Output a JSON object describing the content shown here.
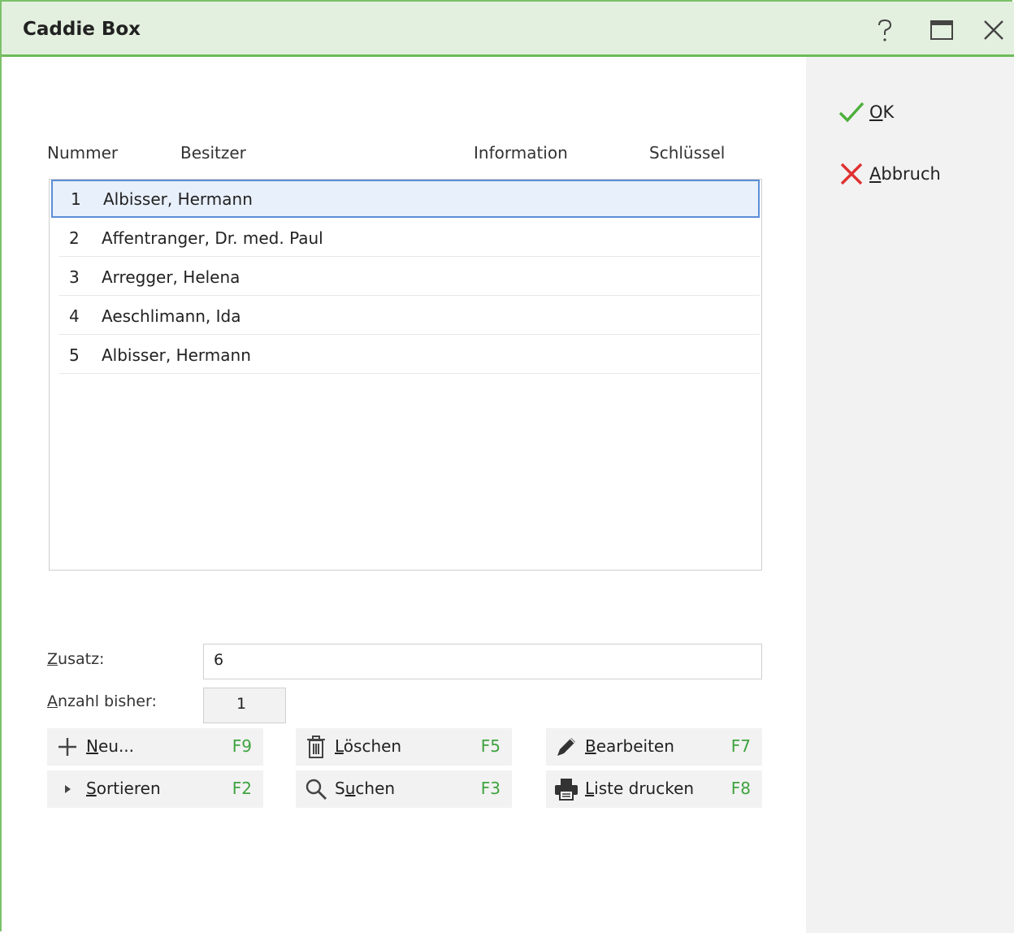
{
  "window": {
    "title": "Caddie Box"
  },
  "titlebar_icons": {
    "help": "help-icon",
    "maximize": "maximize-icon",
    "close": "close-icon"
  },
  "side": {
    "ok_label": "OK",
    "ok_mnemonic": "O",
    "ok_rest": "K",
    "cancel_label": "Abbruch",
    "cancel_mnemonic": "A",
    "cancel_rest": "bbruch"
  },
  "table": {
    "columns": [
      "Nummer",
      "Besitzer",
      "Information",
      "Schlüssel"
    ],
    "rows": [
      {
        "num": "1",
        "owner": "Albisser, Hermann",
        "information": "",
        "key": ""
      },
      {
        "num": "2",
        "owner": "Affentranger, Dr. med. Paul",
        "information": "",
        "key": ""
      },
      {
        "num": "3",
        "owner": "Arregger, Helena",
        "information": "",
        "key": ""
      },
      {
        "num": "4",
        "owner": "Aeschlimann, Ida",
        "information": "",
        "key": ""
      },
      {
        "num": "5",
        "owner": "Albisser, Hermann",
        "information": "",
        "key": ""
      }
    ],
    "selected_row": 1
  },
  "form": {
    "zusatz_label_m": "Z",
    "zusatz_label_rest": "usatz:",
    "zusatz_value": "6",
    "anzahl_label_m": "A",
    "anzahl_label_rest": "nzahl bisher:",
    "anzahl_value": "1"
  },
  "actions": {
    "new": {
      "m": "N",
      "rest": "eu...",
      "key": "F9"
    },
    "delete": {
      "m": "L",
      "rest": "öschen",
      "key": "F5"
    },
    "edit": {
      "m": "B",
      "rest": "earbeiten",
      "key": "F7"
    },
    "sort": {
      "m": "S",
      "rest": "ortieren",
      "key": "F2"
    },
    "search_pre": "S",
    "search": {
      "m": "u",
      "rest": "chen",
      "key": "F3"
    },
    "print": {
      "m": "L",
      "rest": "iste drucken",
      "key": "F8"
    }
  },
  "colors": {
    "accent_green": "#6cbb5a",
    "titlebar_bg": "#e4f0df",
    "selection_border": "#5b8fd6",
    "shortcut_green": "#3fa33f"
  }
}
